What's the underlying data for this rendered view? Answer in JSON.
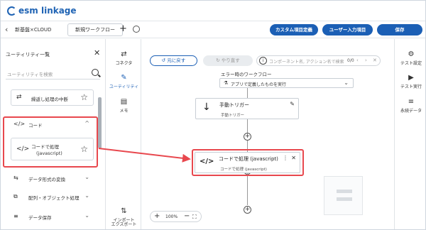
{
  "app": {
    "logo": "esm linkage"
  },
  "breadcrumb": {
    "label": "新基盤×CLOUD"
  },
  "tabs": [
    {
      "label": "新規ワークフロー"
    }
  ],
  "header_buttons": {
    "custom_fields": "カスタム項目定義",
    "user_input": "ユーザー入力項目",
    "save": "保存"
  },
  "utility_panel": {
    "title": "ユーティリティ一覧",
    "search_placeholder": "ユーティリティを検索",
    "items": [
      {
        "label": "繰返し処理の中断"
      }
    ],
    "group_code": {
      "label": "コード",
      "item": {
        "label_line1": "コードで処理",
        "label_line2": "(javascript)"
      }
    },
    "groups_after": [
      {
        "label": "データ形式の変換"
      },
      {
        "label": "配列・オブジェクト処理"
      },
      {
        "label": "データ保存"
      }
    ]
  },
  "left_rail": [
    {
      "label": "コネクタ"
    },
    {
      "label": "ユーティリティ"
    },
    {
      "label": "メモ"
    },
    {
      "label": "インポート"
    },
    {
      "label": "エクスポート"
    }
  ],
  "canvas": {
    "undo": "元に戻す",
    "redo": "やり直す",
    "search_placeholder": "コンポーネント名, アクション名で検索",
    "search_count": "0/0",
    "error_label": "エラー時のワークフロー",
    "error_select": "アプリで定義したものを実行",
    "trigger": {
      "title": "手動トリガー",
      "subtitle": "手動トリガー"
    },
    "code_node": {
      "title": "コードで処理 (javascript)",
      "subtitle": "コードで処理 (javascript)"
    },
    "zoom": "100%"
  },
  "right_rail": [
    {
      "label": "テスト設定"
    },
    {
      "label": "テスト実行"
    },
    {
      "label": "永続データ"
    }
  ],
  "colors": {
    "brand": "#1b5fb5",
    "highlight": "#e8484e"
  }
}
